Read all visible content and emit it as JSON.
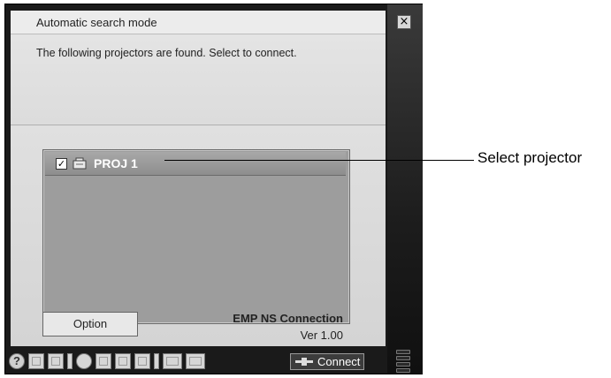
{
  "window": {
    "title": "Automatic search mode",
    "description": "The following projectors are found. Select to connect.",
    "close_glyph": "×"
  },
  "projector_list": {
    "items": [
      {
        "label": "PROJ 1",
        "checked": true
      }
    ]
  },
  "footer": {
    "option_label": "Option",
    "product_name": "EMP NS Connection",
    "version": "Ver 1.00"
  },
  "toolbar": {
    "help_glyph": "?",
    "connect_label": "Connect"
  },
  "callout": {
    "text": "Select projector"
  }
}
